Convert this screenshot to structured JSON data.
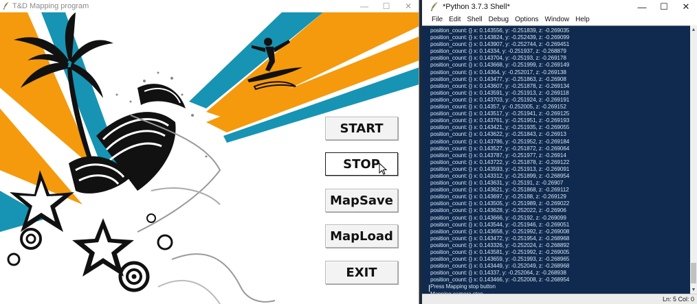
{
  "app": {
    "title": "T&D Mapping program",
    "window_controls": {
      "minimize": "—",
      "maximize": "☐",
      "close": "✕"
    },
    "buttons": {
      "start": "START",
      "stop": "STOP",
      "mapsave": "MapSave",
      "mapload": "MapLoad",
      "exit": "EXIT"
    },
    "colors": {
      "orange": "#f59a0c",
      "teal": "#1794b3",
      "black": "#111111"
    }
  },
  "shell": {
    "title": "*Python 3.7.3 Shell*",
    "window_controls": {
      "minimize": "—",
      "maximize": "☐",
      "close": "✕"
    },
    "menu": [
      "File",
      "Edit",
      "Shell",
      "Debug",
      "Options",
      "Window",
      "Help"
    ],
    "lines": [
      "position_count: {} x: 0.143556,  y: -0.251839,  z: -0.269035",
      "position_count: {} x: 0.143824,  y: -0.252439,  z: -0.269099",
      "position_count: {} x: 0.143907,  y: -0.252744,  z: -0.269451",
      "position_count: {} x: 0.14334,  y: -0.251937,  z: -0.268879",
      "position_count: {} x: 0.143704,  y: -0.25193,  z: -0.269178",
      "position_count: {} x: 0.143668,  y: -0.251999,  z: -0.269149",
      "position_count: {} x: 0.14364,  y: -0.252017,  z: -0.269138",
      "position_count: {} x: 0.143477,  y: -0.251863,  z: -0.26908",
      "position_count: {} x: 0.143607,  y: -0.251878,  z: -0.269134",
      "position_count: {} x: 0.143591,  y: -0.251913,  z: -0.269118",
      "position_count: {} x: 0.143703,  y: -0.251924,  z: -0.269191",
      "position_count: {} x: 0.14357,  y: -0.252005,  z: -0.269152",
      "position_count: {} x: 0.143517,  y: -0.251941,  z: -0.269125",
      "position_count: {} x: 0.143761,  y: -0.251951,  z: -0.269193",
      "position_count: {} x: 0.143421,  y: -0.251935,  z: -0.269055",
      "position_count: {} x: 0.143622,  y: -0.251843,  z: -0.26913",
      "position_count: {} x: 0.143786,  y: -0.251952,  z: -0.269184",
      "position_count: {} x: 0.143527,  y: -0.251872,  z: -0.269064",
      "position_count: {} x: 0.143787,  y: -0.251977,  z: -0.26914",
      "position_count: {} x: 0.143722,  y: -0.251878,  z: -0.269122",
      "position_count: {} x: 0.143593,  y: -0.251913,  z: -0.269091",
      "position_count: {} x: 0.143312,  y: -0.251899,  z: -0.268954",
      "position_count: {} x: 0.143631,  y: -0.25191,  z: -0.26907",
      "position_count: {} x: 0.143621,  y: -0.251868,  z: -0.269112",
      "position_count: {} x: 0.143697,  y: -0.25188,  z: -0.269129",
      "position_count: {} x: 0.143505,  y: -0.251989,  z: -0.269022",
      "position_count: {} x: 0.143628,  y: -0.252022,  z: -0.26906",
      "position_count: {} x: 0.143666,  y: -0.25192,  z: -0.269099",
      "position_count: {} x: 0.143544,  y: -0.251946,  z: -0.269051",
      "position_count: {} x: 0.143658,  y: -0.251992,  z: -0.269008",
      "position_count: {} x: 0.143472,  y: -0.251954,  z: -0.268968",
      "position_count: {} x: 0.143326,  y: -0.252024,  z: -0.268892",
      "position_count: {} x: 0.143581,  y: -0.251992,  z: -0.269005",
      "position_count: {} x: 0.143659,  y: -0.251993,  z: -0.268965",
      "position_count: {} x: 0.143449,  y: -0.252049,  z: -0.268968",
      "position_count: {} x: 0.14337,  y: -0.252064,  z: -0.268938",
      "position_count: {} x: 0.143466,  y: -0.252008,  z: -0.268954",
      "Press Mapping stop button",
      "Mapping camera stop"
    ],
    "status": "Ln: 5   Col: 0"
  }
}
